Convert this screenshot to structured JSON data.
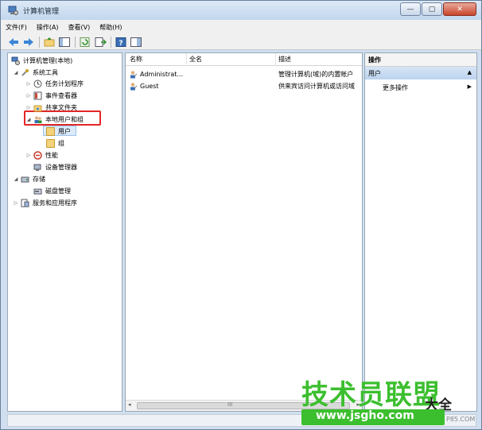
{
  "window": {
    "title": "计算机管理",
    "minimize": "—",
    "maximize": "▢",
    "close": "✕"
  },
  "menubar": [
    "文件(F)",
    "操作(A)",
    "查看(V)",
    "帮助(H)"
  ],
  "tree": {
    "root": "计算机管理(本地)",
    "system_tools": "系统工具",
    "task_scheduler": "任务计划程序",
    "event_viewer": "事件查看器",
    "shared_folders": "共享文件夹",
    "local_users_groups": "本地用户和组",
    "users": "用户",
    "groups": "组",
    "performance": "性能",
    "device_manager": "设备管理器",
    "storage": "存储",
    "disk_management": "磁盘管理",
    "services_apps": "服务和应用程序"
  },
  "list": {
    "headers": [
      "名称",
      "全名",
      "描述"
    ],
    "rows": [
      {
        "name": "Administrat...",
        "fullname": "",
        "description": "管理计算机(域)的内置帐户"
      },
      {
        "name": "Guest",
        "fullname": "",
        "description": "供来宾访问计算机或访问域"
      }
    ],
    "scroll_grip": "III"
  },
  "actions": {
    "header": "操作",
    "section": "用户",
    "more": "更多操作"
  },
  "watermark": {
    "main": "技术员联盟",
    "side": "大全",
    "url": "www.jsgho.com",
    "small": "P85.COM"
  },
  "colors": {
    "highlight_border": "#e32626",
    "watermark_green": "#3cbf2f",
    "action_section": "#bcd3ee"
  }
}
